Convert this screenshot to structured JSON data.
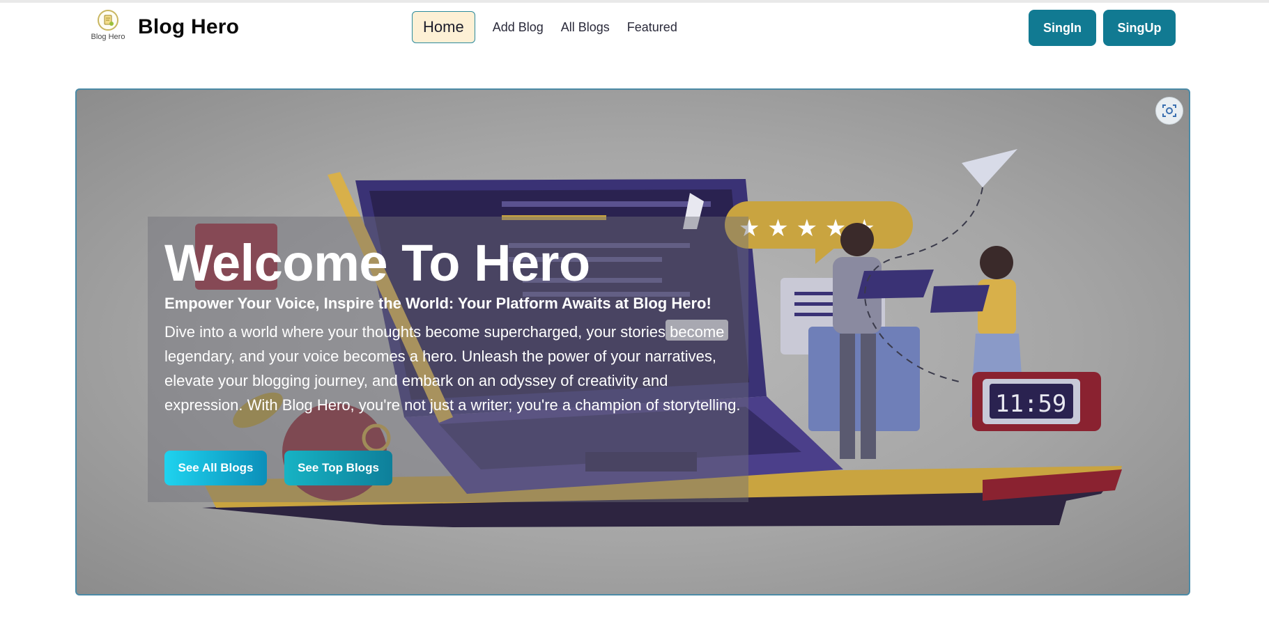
{
  "nav": {
    "logo_text": "Blog Hero",
    "brand": "Blog Hero",
    "menu": [
      {
        "label": "Home",
        "active": true
      },
      {
        "label": "Add Blog"
      },
      {
        "label": "All Blogs"
      },
      {
        "label": "Featured"
      }
    ],
    "signin_label": "SingIn",
    "signup_label": "SingUp"
  },
  "hero": {
    "title": "Welcome To Hero",
    "subtitle": "Empower Your Voice, Inspire the World: Your Platform Awaits at Blog Hero!",
    "description": "Dive into a world where your thoughts become supercharged, your stories become legendary, and your voice becomes a hero. Unleash the power of your narratives, elevate your blogging journey, and embark on an odyssey of creativity and expression. With Blog Hero, you're not just a writer; you're a champion of storytelling.",
    "btn_all_blogs": "See All Blogs",
    "btn_top_blogs": "See Top Blogs",
    "clock_text": "11:59",
    "lens_icon": "visual-search-icon"
  },
  "colors": {
    "primary": "#117a92",
    "active_bg": "#fdf0d5",
    "hero_border": "#4b8aa6"
  }
}
